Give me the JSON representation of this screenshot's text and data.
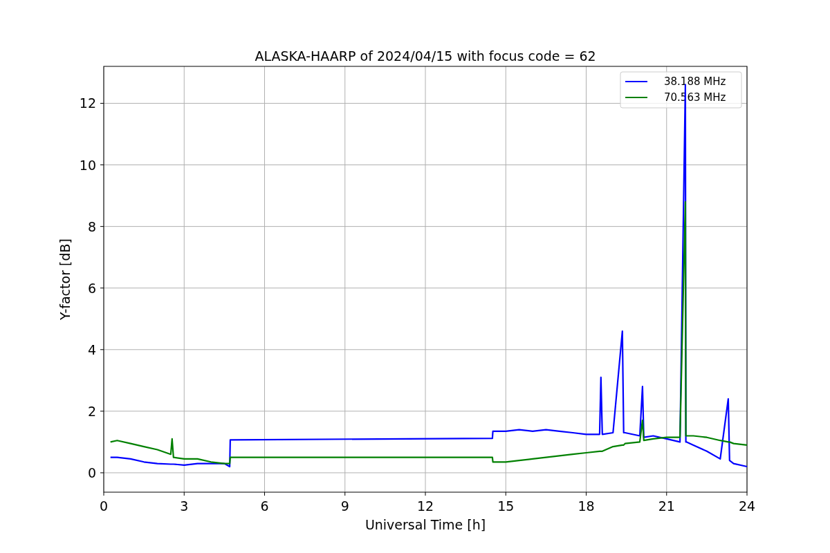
{
  "chart_data": {
    "type": "line",
    "title": "ALASKA-HAARP of 2024/04/15 with focus code = 62",
    "xlabel": "Universal Time [h]",
    "ylabel": "Y-factor [dB]",
    "x": [
      0.25,
      0.5,
      1,
      1.5,
      2,
      2.5,
      2.55,
      2.6,
      3,
      3.5,
      4,
      4.5,
      4.7,
      4.72,
      14.5,
      14.52,
      15,
      15.5,
      16,
      16.5,
      17,
      17.5,
      18,
      18.5,
      18.55,
      18.6,
      19,
      19.35,
      19.4,
      19.45,
      20,
      20.1,
      20.15,
      20.5,
      21,
      21.5,
      21.7,
      21.72,
      21.75,
      22,
      22.5,
      23,
      23.3,
      23.35,
      23.5,
      24
    ],
    "series": [
      {
        "name": "38.188 MHz",
        "color": "#0000ff",
        "values": [
          0.5,
          0.5,
          0.45,
          0.35,
          0.3,
          0.28,
          0.28,
          0.28,
          0.25,
          0.3,
          0.3,
          0.3,
          0.2,
          1.07,
          1.12,
          1.35,
          1.35,
          1.4,
          1.35,
          1.4,
          1.35,
          1.3,
          1.25,
          1.25,
          3.1,
          1.25,
          1.3,
          4.6,
          1.3,
          1.3,
          1.2,
          2.8,
          1.15,
          1.2,
          1.1,
          1.0,
          12.6,
          1.0,
          1.0,
          0.9,
          0.7,
          0.45,
          2.4,
          0.4,
          0.3,
          0.2
        ]
      },
      {
        "name": "70.563 MHz",
        "color": "#008000",
        "values": [
          1.0,
          1.05,
          0.95,
          0.85,
          0.75,
          0.6,
          1.1,
          0.5,
          0.45,
          0.45,
          0.35,
          0.3,
          0.3,
          0.5,
          0.5,
          0.35,
          0.35,
          0.4,
          0.45,
          0.5,
          0.55,
          0.6,
          0.65,
          0.7,
          0.7,
          0.7,
          0.85,
          0.9,
          0.9,
          0.95,
          1.0,
          1.7,
          1.05,
          1.1,
          1.15,
          1.15,
          8.8,
          1.2,
          1.2,
          1.2,
          1.15,
          1.05,
          1.0,
          1.0,
          0.95,
          0.9
        ]
      }
    ],
    "grid": true,
    "legend": true,
    "xlim": [
      0,
      24
    ],
    "ylim": [
      -0.63,
      13.2
    ],
    "xticks": [
      0,
      3,
      6,
      9,
      12,
      15,
      18,
      21,
      24
    ],
    "yticks": [
      0,
      2,
      4,
      6,
      8,
      10,
      12
    ]
  }
}
